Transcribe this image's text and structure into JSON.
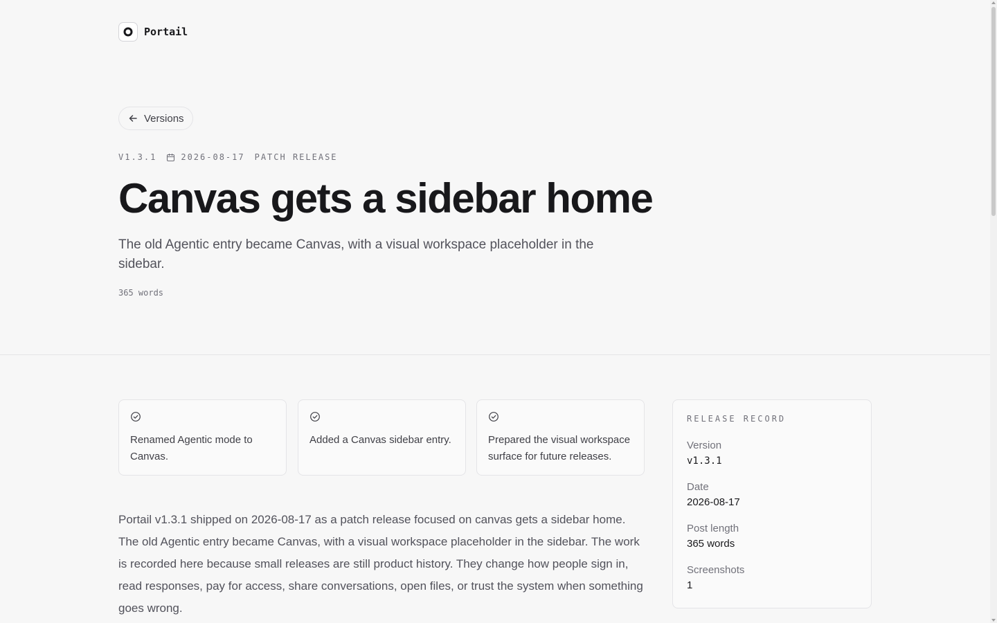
{
  "brand": {
    "name": "Portail",
    "icon": "portail-logo-icon"
  },
  "nav": {
    "back_label": "Versions",
    "back_icon": "arrow-left-icon"
  },
  "meta": {
    "version": "V1.3.1",
    "date": "2026-08-17",
    "type": "PATCH RELEASE",
    "date_icon": "calendar-icon"
  },
  "title": "Canvas gets a sidebar home",
  "subtitle": "The old Agentic entry became Canvas, with a visual workspace placeholder in the sidebar.",
  "word_count": "365 words",
  "highlights": [
    {
      "icon": "check-circle-icon",
      "text": "Renamed Agentic mode to Canvas."
    },
    {
      "icon": "check-circle-icon",
      "text": "Added a Canvas sidebar entry."
    },
    {
      "icon": "check-circle-icon",
      "text": "Prepared the visual workspace surface for future releases."
    }
  ],
  "body": "Portail v1.3.1 shipped on 2026-08-17 as a patch release focused on canvas gets a sidebar home. The old Agentic entry became Canvas, with a visual workspace placeholder in the sidebar. The work is recorded here because small releases are still product history. They change how people sign in, read responses, pay for access, share conversations, open files, or trust the system when something goes wrong.",
  "record": {
    "title": "RELEASE RECORD",
    "rows": [
      {
        "label": "Version",
        "value": "v1.3.1"
      },
      {
        "label": "Date",
        "value": "2026-08-17"
      },
      {
        "label": "Post length",
        "value": "365 words"
      },
      {
        "label": "Screenshots",
        "value": "1"
      }
    ]
  },
  "colors": {
    "background": "#f7f7f7",
    "text": "#18181b",
    "muted": "#71717a",
    "border": "#e4e4e7"
  }
}
